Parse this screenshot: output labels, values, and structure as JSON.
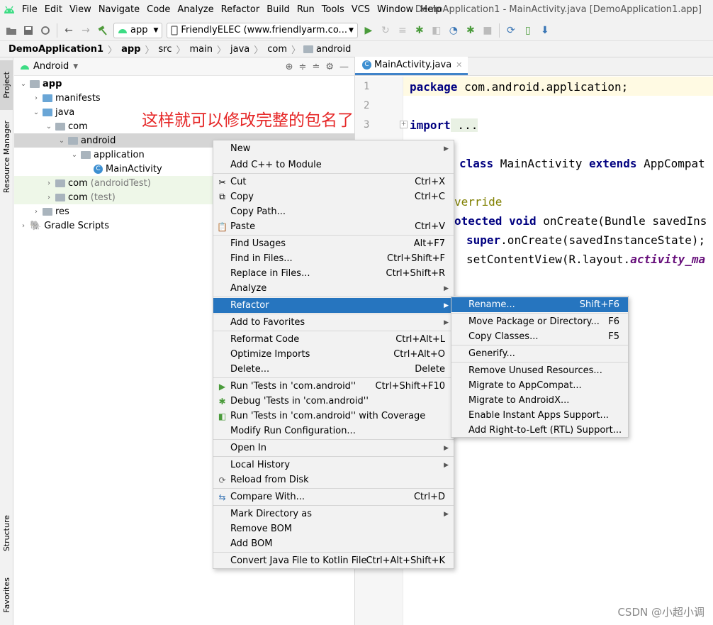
{
  "menubar": {
    "items": [
      "File",
      "Edit",
      "View",
      "Navigate",
      "Code",
      "Analyze",
      "Refactor",
      "Build",
      "Run",
      "Tools",
      "VCS",
      "Window",
      "Help"
    ],
    "window_title": "DemoApplication1 - MainActivity.java [DemoApplication1.app]"
  },
  "toolbar": {
    "run_config": "app",
    "device": "FriendlyELEC (www.friendlyarm.co..."
  },
  "breadcrumb": [
    "DemoApplication1",
    "app",
    "src",
    "main",
    "java",
    "com",
    "android"
  ],
  "left_strip": {
    "project": "Project",
    "resource_manager": "Resource Manager",
    "structure": "Structure",
    "favorites": "Favorites"
  },
  "project_panel": {
    "view_mode": "Android",
    "tree": [
      {
        "label": "app",
        "extra": ""
      },
      {
        "label": "manifests",
        "extra": ""
      },
      {
        "label": "java",
        "extra": ""
      },
      {
        "label": "com",
        "extra": ""
      },
      {
        "label": "android",
        "extra": ""
      },
      {
        "label": "application",
        "extra": ""
      },
      {
        "label": "MainActivity",
        "extra": ""
      },
      {
        "label": "com",
        "extra": "(androidTest)"
      },
      {
        "label": "com",
        "extra": "(test)"
      },
      {
        "label": "res",
        "extra": ""
      },
      {
        "label": "Gradle Scripts",
        "extra": ""
      }
    ]
  },
  "annotation": "这样就可以修改完整的包名了",
  "editor": {
    "tab": "MainActivity.java",
    "line_numbers": [
      "1",
      "2",
      "3"
    ],
    "code": {
      "l1_kw": "package",
      "l1_rest": " com.android.application;",
      "l3_kw": "import",
      "l3_rest": " ...",
      "l5_kw1": "class",
      "l5_mid": " MainActivity ",
      "l5_kw2": "extends",
      "l5_rest": " AppCompat",
      "l7_ann": "verride",
      "l8_kw1": "otected",
      "l8_sp": " ",
      "l8_kw2": "void",
      "l8_rest": " onCreate(Bundle savedIns",
      "l9_kw": "super",
      "l9_rest": ".onCreate(savedInstanceState);",
      "l10_a": "setContentView(R.layout.",
      "l10_b": "activity_ma"
    }
  },
  "context_menu": {
    "items": [
      {
        "label": "New",
        "shortcut": "",
        "submenu": true
      },
      {
        "label": "Add C++ to Module",
        "shortcut": "",
        "submenu": false
      },
      {
        "label": "Cut",
        "shortcut": "Ctrl+X",
        "submenu": false
      },
      {
        "label": "Copy",
        "shortcut": "Ctrl+C",
        "submenu": false
      },
      {
        "label": "Copy Path...",
        "shortcut": "",
        "submenu": false
      },
      {
        "label": "Paste",
        "shortcut": "Ctrl+V",
        "submenu": false
      },
      {
        "label": "Find Usages",
        "shortcut": "Alt+F7",
        "submenu": false
      },
      {
        "label": "Find in Files...",
        "shortcut": "Ctrl+Shift+F",
        "submenu": false
      },
      {
        "label": "Replace in Files...",
        "shortcut": "Ctrl+Shift+R",
        "submenu": false
      },
      {
        "label": "Analyze",
        "shortcut": "",
        "submenu": true
      },
      {
        "label": "Refactor",
        "shortcut": "",
        "submenu": true
      },
      {
        "label": "Add to Favorites",
        "shortcut": "",
        "submenu": true
      },
      {
        "label": "Reformat Code",
        "shortcut": "Ctrl+Alt+L",
        "submenu": false
      },
      {
        "label": "Optimize Imports",
        "shortcut": "Ctrl+Alt+O",
        "submenu": false
      },
      {
        "label": "Delete...",
        "shortcut": "Delete",
        "submenu": false
      },
      {
        "label": "Run 'Tests in 'com.android''",
        "shortcut": "Ctrl+Shift+F10",
        "submenu": false
      },
      {
        "label": "Debug 'Tests in 'com.android''",
        "shortcut": "",
        "submenu": false
      },
      {
        "label": "Run 'Tests in 'com.android'' with Coverage",
        "shortcut": "",
        "submenu": false
      },
      {
        "label": "Modify Run Configuration...",
        "shortcut": "",
        "submenu": false
      },
      {
        "label": "Open In",
        "shortcut": "",
        "submenu": true
      },
      {
        "label": "Local History",
        "shortcut": "",
        "submenu": true
      },
      {
        "label": "Reload from Disk",
        "shortcut": "",
        "submenu": false
      },
      {
        "label": "Compare With...",
        "shortcut": "Ctrl+D",
        "submenu": false
      },
      {
        "label": "Mark Directory as",
        "shortcut": "",
        "submenu": true
      },
      {
        "label": "Remove BOM",
        "shortcut": "",
        "submenu": false
      },
      {
        "label": "Add BOM",
        "shortcut": "",
        "submenu": false
      },
      {
        "label": "Convert Java File to Kotlin File",
        "shortcut": "Ctrl+Alt+Shift+K",
        "submenu": false
      }
    ]
  },
  "refactor_submenu": {
    "items": [
      {
        "label": "Rename...",
        "shortcut": "Shift+F6"
      },
      {
        "label": "Move Package or Directory...",
        "shortcut": "F6"
      },
      {
        "label": "Copy Classes...",
        "shortcut": "F5"
      },
      {
        "label": "Generify...",
        "shortcut": ""
      },
      {
        "label": "Remove Unused Resources...",
        "shortcut": ""
      },
      {
        "label": "Migrate to AppCompat...",
        "shortcut": ""
      },
      {
        "label": "Migrate to AndroidX...",
        "shortcut": ""
      },
      {
        "label": "Enable Instant Apps Support...",
        "shortcut": ""
      },
      {
        "label": "Add Right-to-Left (RTL) Support...",
        "shortcut": ""
      }
    ]
  },
  "watermark": "CSDN @小超小调",
  "colors": {
    "selection": "#2675bf",
    "annotation": "#e62828",
    "keyword": "#000080"
  }
}
